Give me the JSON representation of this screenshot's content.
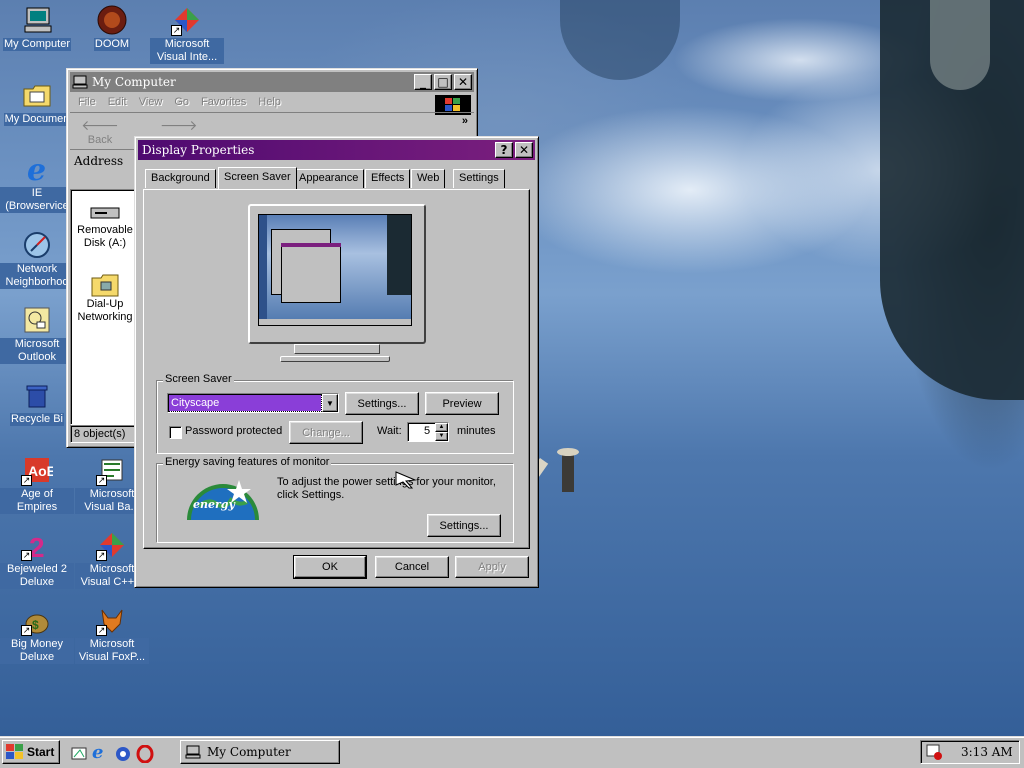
{
  "desktop": {
    "icons": [
      {
        "name": "my-computer",
        "label": "My Computer",
        "shortcut": false
      },
      {
        "name": "doom",
        "label": "DOOM",
        "shortcut": false
      },
      {
        "name": "ms-visual-interdev",
        "label": "Microsoft Visual Inte...",
        "shortcut": true
      },
      {
        "name": "my-documents",
        "label": "My Documen",
        "shortcut": false
      },
      {
        "name": "ie",
        "label": "IE (Browservice",
        "shortcut": false
      },
      {
        "name": "network",
        "label": "Network Neighborhoo",
        "shortcut": false
      },
      {
        "name": "outlook",
        "label": "Microsoft Outlook",
        "shortcut": false
      },
      {
        "name": "recycle",
        "label": "Recycle Bi",
        "shortcut": false
      },
      {
        "name": "aoe",
        "label": "Age of Empires",
        "shortcut": true
      },
      {
        "name": "ms-visual-basic",
        "label": "Microsoft Visual Ba...",
        "shortcut": true
      },
      {
        "name": "bejeweled",
        "label": "Bejeweled 2 Deluxe",
        "shortcut": true
      },
      {
        "name": "ms-visual-cpp",
        "label": "Microsoft Visual C++ 6",
        "shortcut": true
      },
      {
        "name": "bigmoney",
        "label": "Big Money Deluxe",
        "shortcut": true
      },
      {
        "name": "ms-visual-foxpro",
        "label": "Microsoft Visual FoxP...",
        "shortcut": true
      }
    ]
  },
  "my_computer": {
    "title": "My Computer",
    "menu": [
      "File",
      "Edit",
      "View",
      "Go",
      "Favorites",
      "Help"
    ],
    "toolbar": {
      "back": "Back",
      "more": "»"
    },
    "address_label": "Address",
    "items": [
      "Removable Disk (A:)",
      "Dial-Up Networking"
    ],
    "status": "8 object(s)"
  },
  "display_properties": {
    "title": "Display Properties",
    "help_btn": "?",
    "close_btn": "✕",
    "tabs": [
      "Background",
      "Screen Saver",
      "Appearance",
      "Effects",
      "Web",
      "Settings"
    ],
    "active_tab": "Screen Saver",
    "screen_saver": {
      "group_label": "Screen Saver",
      "selected": "Cityscape",
      "settings_btn": "Settings...",
      "preview_btn": "Preview",
      "password_label": "Password protected",
      "password_checked": false,
      "change_btn": "Change...",
      "wait_label": "Wait:",
      "wait_value": "5",
      "minutes_label": "minutes"
    },
    "energy": {
      "group_label": "Energy saving features of monitor",
      "text": "To adjust the power settings for your monitor, click Settings.",
      "logo_text": "energy",
      "settings_btn": "Settings..."
    },
    "ok": "OK",
    "cancel": "Cancel",
    "apply": "Apply"
  },
  "taskbar": {
    "start": "Start",
    "task": "My Computer",
    "clock": "3:13 AM"
  },
  "colors": {
    "title_active": "#6d0f71",
    "selection": "#8a3ed8",
    "desktop": "#3f69a2"
  }
}
